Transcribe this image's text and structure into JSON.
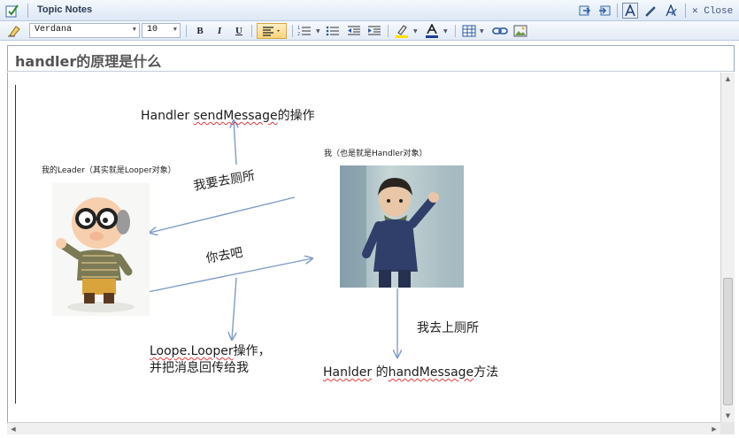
{
  "window": {
    "title": "Topic Notes",
    "close_label": "Close"
  },
  "toolbar": {
    "font_family": "Verdana",
    "font_size": "10",
    "bold_label": "B",
    "italic_label": "I",
    "underline_label": "U"
  },
  "note": {
    "heading": "handler的原理是什么"
  },
  "diagram": {
    "leader_caption": "我的Leader（其实就是Looper对象）",
    "me_caption": "我（也是就是Handler对象）",
    "send_message_prefix": "Handler ",
    "send_message_method": "sendMessage",
    "send_message_suffix": "的操作",
    "toilet_request": "我要去厕所",
    "go_ahead": "你去吧",
    "looper_line1_method": "Loope.Looper",
    "looper_line1_suffix": "操作，",
    "looper_line2": "并把消息回传给我",
    "go_toilet": "我去上厕所",
    "handle_message_prefix": "Hanlder",
    "handle_message_mid": " 的",
    "handle_message_method": "handMessage",
    "handle_message_suffix": "方法"
  },
  "colors": {
    "arrow": "#7f9cc5",
    "heading_text": "#545454",
    "spell_underline": "#e23b3b"
  }
}
